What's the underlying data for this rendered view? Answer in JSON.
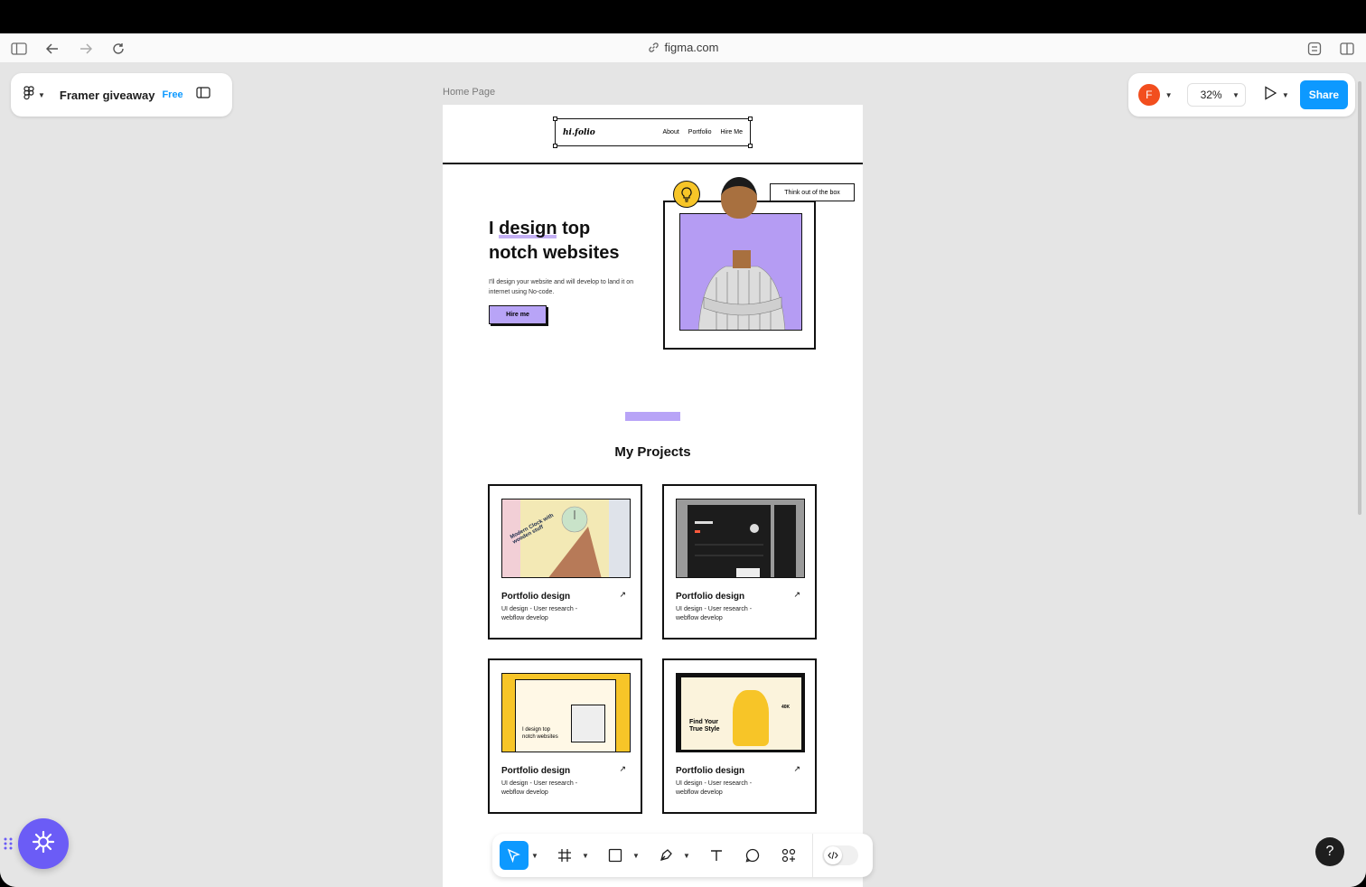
{
  "browser": {
    "url": "figma.com"
  },
  "file": {
    "name": "Framer giveaway",
    "plan": "Free"
  },
  "toolbar_right": {
    "avatar_initial": "F",
    "zoom": "32%",
    "share_label": "Share"
  },
  "frame": {
    "label": "Home Page"
  },
  "site": {
    "brand": "hi.folio",
    "nav": [
      "About",
      "Portfolio",
      "Hire Me"
    ],
    "hero_line1": "I design top",
    "hero_line2": "notch websites",
    "hero_sub": "I'll design your website and will develop to land it on internet using No-code.",
    "hire_label": "Hire me",
    "tag": "Think out  of the box",
    "projects_title": "My Projects",
    "projects": [
      {
        "title": "Portfolio design",
        "desc": "UI design - User research - webflow develop"
      },
      {
        "title": "Portfolio design",
        "desc": "UI design - User research - webflow develop"
      },
      {
        "title": "Portfolio design",
        "desc": "UI design - User research - webflow develop"
      },
      {
        "title": "Portfolio design",
        "desc": "UI design - User research - webflow develop"
      }
    ],
    "thumb_texts": {
      "t1": "Modern Clock with wooden stuff",
      "t3_line1": "I design top",
      "t3_line2": "notch websites",
      "t4_line1": "Find Your",
      "t4_line2": "True Style",
      "t4_stat": "40K"
    }
  },
  "colors": {
    "accent": "#0d99ff",
    "purple": "#b59cf3",
    "plugin": "#6b5cf6"
  },
  "icons": [
    "sidebar-toggle-icon",
    "back-icon",
    "forward-icon",
    "reload-icon",
    "link-icon",
    "extensions-icon",
    "split-view-icon",
    "figma-logo-icon",
    "panel-icon",
    "play-icon",
    "move-tool-icon",
    "frame-tool-icon",
    "rectangle-tool-icon",
    "pen-tool-icon",
    "text-tool-icon",
    "comment-tool-icon",
    "actions-icon",
    "dev-mode-icon",
    "help-icon"
  ]
}
